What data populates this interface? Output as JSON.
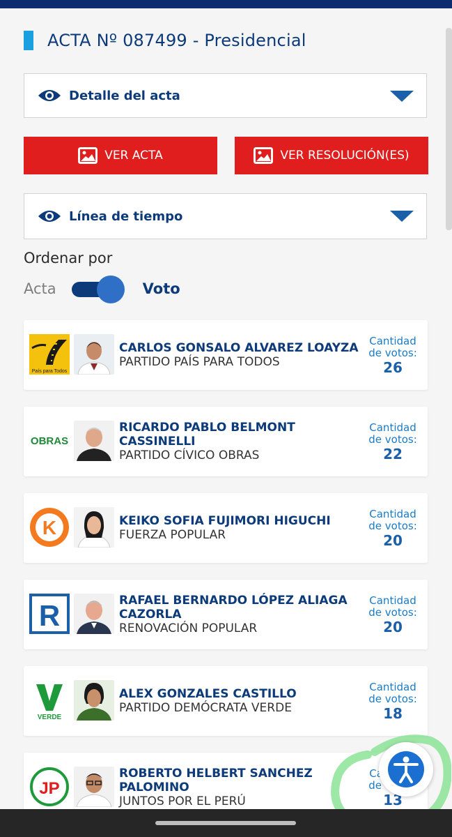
{
  "acta": {
    "title": "ACTA Nº 087499 - Presidencial"
  },
  "sections": {
    "detalle": "Detalle del acta",
    "timeline": "Línea de tiempo"
  },
  "buttons": {
    "ver_acta": "VER ACTA",
    "ver_resoluciones": "VER RESOLUCIÓN(ES)"
  },
  "order": {
    "label": "Ordenar por",
    "left": "Acta",
    "right": "Voto",
    "selected": "Voto"
  },
  "votes_label_1": "Cantidad",
  "votes_label_2": "de votos:",
  "colors": {
    "accent": "#0d3b7a",
    "red": "#e01e1e",
    "light_blue": "#1a9fe0"
  },
  "candidates": [
    {
      "name": "CARLOS GONSALO ALVAREZ LOAYZA",
      "party": "PARTIDO PAÍS PARA TODOS",
      "votes": "26",
      "logo_text": "País para Todos",
      "logo_icon": "road-icon"
    },
    {
      "name": "RICARDO PABLO BELMONT CASSINELLI",
      "party": "PARTIDO CÍVICO OBRAS",
      "votes": "22",
      "logo_text": "OBRAS",
      "logo_icon": "obras-logo"
    },
    {
      "name": "KEIKO SOFIA FUJIMORI HIGUCHI",
      "party": "FUERZA POPULAR",
      "votes": "20",
      "logo_text": "K",
      "logo_icon": "k-logo"
    },
    {
      "name": "RAFAEL BERNARDO LÓPEZ ALIAGA CAZORLA",
      "party": "RENOVACIÓN POPULAR",
      "votes": "20",
      "logo_text": "R",
      "logo_icon": "r-logo"
    },
    {
      "name": "ALEX GONZALES CASTILLO",
      "party": "PARTIDO DEMÓCRATA VERDE",
      "votes": "18",
      "logo_text": "VERDE",
      "logo_icon": "v-logo"
    },
    {
      "name": "ROBERTO HELBERT SANCHEZ PALOMINO",
      "party": "JUNTOS POR EL PERÚ",
      "votes": "13",
      "logo_text": "JP",
      "logo_icon": "jp-logo"
    }
  ]
}
